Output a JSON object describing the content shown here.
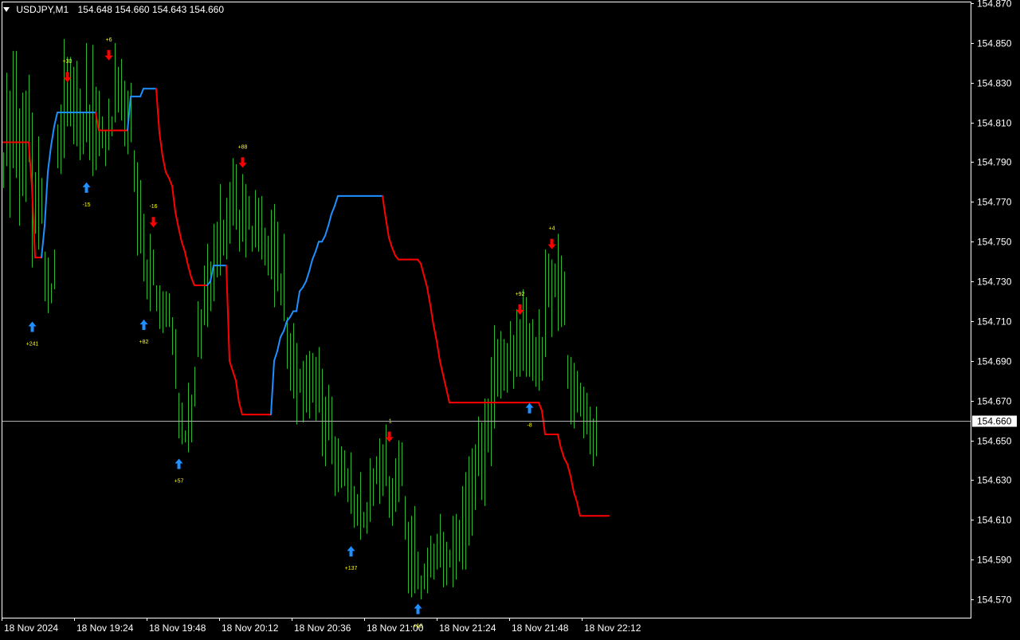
{
  "window": {
    "symbol_label": "USDJPY,M1",
    "ohlc": "154.648 154.660 154.643 154.660"
  },
  "colors": {
    "background": "#000000",
    "frame": "#ffffff",
    "bars": "#2eb82e",
    "trend_up": "#1e90ff",
    "trend_down": "#ff0000",
    "arrow_up": "#1e90ff",
    "arrow_down": "#ff0000",
    "signal_text": "#ffff00",
    "text": "#ffffff",
    "price_line": "#b0b0b0"
  },
  "chart_data": {
    "type": "ohlc-bars",
    "symbol": "USDJPY",
    "timeframe": "M1",
    "ylim": [
      154.565,
      154.87
    ],
    "y_ticks": [
      "154.870",
      "154.850",
      "154.830",
      "154.810",
      "154.790",
      "154.770",
      "154.750",
      "154.730",
      "154.710",
      "154.690",
      "154.670",
      "154.650",
      "154.630",
      "154.610",
      "154.590",
      "154.570"
    ],
    "x_ticks": [
      "18 Nov 2024",
      "18 Nov 19:24",
      "18 Nov 19:48",
      "18 Nov 20:12",
      "18 Nov 20:36",
      "18 Nov 21:00",
      "18 Nov 21:24",
      "18 Nov 21:48",
      "18 Nov 22:12"
    ],
    "bar_count": 183,
    "current_price": "154.660",
    "highs": [
      154.795,
      154.835,
      154.826,
      154.846,
      154.846,
      154.817,
      154.825,
      154.826,
      154.834,
      154.815,
      154.785,
      154.803,
      154.782,
      154.745,
      154.742,
      154.729,
      154.746,
      154.809,
      154.819,
      154.852,
      154.843,
      154.843,
      154.838,
      154.841,
      154.827,
      154.815,
      154.85,
      154.819,
      154.849,
      154.828,
      154.826,
      154.813,
      154.806,
      154.822,
      154.813,
      154.85,
      154.838,
      154.842,
      154.831,
      154.826,
      154.83,
      154.796,
      154.79,
      154.781,
      154.764,
      154.741,
      154.754,
      154.746,
      154.728,
      154.728,
      154.725,
      154.725,
      154.724,
      154.712,
      154.706,
      154.674,
      154.669,
      154.655,
      154.679,
      154.673,
      154.687,
      154.72,
      154.716,
      154.738,
      154.749,
      154.74,
      154.759,
      154.76,
      154.779,
      154.761,
      154.772,
      154.78,
      154.792,
      154.789,
      154.766,
      154.784,
      154.779,
      154.773,
      154.758,
      154.776,
      154.772,
      154.773,
      154.757,
      154.753,
      154.766,
      154.769,
      154.76,
      154.734,
      154.754,
      154.712,
      154.704,
      154.709,
      154.699,
      154.686,
      154.69,
      154.693,
      154.695,
      154.694,
      154.692,
      154.697,
      154.686,
      154.672,
      154.678,
      154.672,
      154.652,
      154.651,
      154.647,
      154.645,
      154.636,
      154.644,
      154.627,
      154.623,
      154.634,
      154.614,
      154.619,
      154.641,
      154.636,
      154.642,
      154.651,
      154.648,
      154.658,
      154.632,
      154.631,
      154.641,
      154.65,
      154.649,
      154.622,
      154.609,
      154.612,
      154.617,
      154.594,
      154.582,
      154.588,
      154.596,
      154.602,
      154.598,
      154.603,
      154.613,
      154.604,
      154.599,
      154.595,
      154.612,
      154.613,
      154.61,
      154.627,
      154.634,
      154.642,
      154.646,
      154.648,
      154.662,
      154.659,
      154.671,
      154.671,
      154.692,
      154.708,
      154.701,
      154.705,
      154.701,
      154.699,
      154.71,
      154.703,
      154.716,
      154.711,
      154.726,
      154.722,
      154.709,
      154.711,
      154.702,
      154.716,
      154.702,
      154.746,
      154.744,
      154.741,
      154.739,
      154.754,
      154.743,
      154.735,
      154.693,
      154.692,
      154.689,
      154.685,
      154.679,
      154.677,
      154.674,
      154.667,
      154.661,
      154.667
    ],
    "lows": [
      154.777,
      154.788,
      154.762,
      154.787,
      154.782,
      154.758,
      154.773,
      154.77,
      154.79,
      154.737,
      154.754,
      154.746,
      154.759,
      154.72,
      154.714,
      154.719,
      154.726,
      154.787,
      154.784,
      154.792,
      154.808,
      154.808,
      154.799,
      154.798,
      154.791,
      154.794,
      154.8,
      154.791,
      154.783,
      154.786,
      154.793,
      154.797,
      154.788,
      154.796,
      154.803,
      154.81,
      154.815,
      154.811,
      154.798,
      154.794,
      154.8,
      154.775,
      154.743,
      154.744,
      154.73,
      154.721,
      154.715,
      154.728,
      154.715,
      154.706,
      154.704,
      154.707,
      154.707,
      154.693,
      154.676,
      154.651,
      154.648,
      154.649,
      154.644,
      154.649,
      154.667,
      154.692,
      154.691,
      154.708,
      154.707,
      154.715,
      154.72,
      154.732,
      154.733,
      154.743,
      154.741,
      154.749,
      154.758,
      154.756,
      154.745,
      154.75,
      154.742,
      154.756,
      154.745,
      154.747,
      154.745,
      154.741,
      154.738,
      154.733,
      154.731,
      154.717,
      154.725,
      154.718,
      154.71,
      154.686,
      154.675,
      154.671,
      154.658,
      154.674,
      154.659,
      154.664,
      154.661,
      154.669,
      154.66,
      154.664,
      154.642,
      154.637,
      154.65,
      154.638,
      154.622,
      154.624,
      154.626,
      154.627,
      154.619,
      154.613,
      154.606,
      154.607,
      154.6,
      154.606,
      154.603,
      154.609,
      154.617,
      154.628,
      154.618,
      154.622,
      154.627,
      154.611,
      154.607,
      154.614,
      154.619,
      154.627,
      154.6,
      154.573,
      154.571,
      154.573,
      154.575,
      154.57,
      154.575,
      154.573,
      154.581,
      154.58,
      154.585,
      154.586,
      154.576,
      154.577,
      154.586,
      154.576,
      154.58,
      154.589,
      154.585,
      154.585,
      154.597,
      154.602,
      154.615,
      154.632,
      154.62,
      154.617,
      154.644,
      154.637,
      154.656,
      154.672,
      154.671,
      154.675,
      154.674,
      154.685,
      154.676,
      154.682,
      154.682,
      154.685,
      154.682,
      154.682,
      154.68,
      154.677,
      154.675,
      154.68,
      154.692,
      154.717,
      154.702,
      154.722,
      154.705,
      154.707,
      154.708,
      154.676,
      154.658,
      154.656,
      154.664,
      154.662,
      154.651,
      154.653,
      154.643,
      154.637,
      154.642
    ],
    "trend": [
      154.8,
      154.8,
      154.8,
      154.8,
      154.8,
      154.8,
      154.8,
      154.8,
      154.8,
      154.778,
      154.742,
      154.742,
      154.742,
      154.758,
      154.785,
      154.798,
      154.808,
      154.815,
      154.815,
      154.815,
      154.815,
      154.815,
      154.815,
      154.815,
      154.815,
      154.815,
      154.815,
      154.815,
      154.815,
      154.815,
      154.806,
      154.806,
      154.806,
      154.806,
      154.806,
      154.806,
      154.806,
      154.806,
      154.806,
      154.806,
      154.823,
      154.823,
      154.823,
      154.823,
      154.827,
      154.827,
      154.827,
      154.827,
      154.827,
      154.805,
      154.793,
      154.785,
      154.782,
      154.778,
      154.765,
      154.757,
      154.75,
      154.745,
      154.738,
      154.732,
      154.728,
      154.728,
      154.728,
      154.728,
      154.728,
      154.73,
      154.738,
      154.738,
      154.738,
      154.738,
      154.738,
      154.69,
      154.685,
      154.68,
      154.669,
      154.663,
      154.663,
      154.663,
      154.663,
      154.663,
      154.663,
      154.663,
      154.663,
      154.663,
      154.663,
      154.69,
      154.695,
      154.702,
      154.705,
      154.71,
      154.712,
      154.715,
      154.715,
      154.725,
      154.727,
      154.73,
      154.735,
      154.741,
      154.745,
      154.75,
      154.75,
      154.753,
      154.758,
      154.764,
      154.768,
      154.773,
      154.773,
      154.773,
      154.773,
      154.773,
      154.773,
      154.773,
      154.773,
      154.773,
      154.773,
      154.773,
      154.773,
      154.773,
      154.773,
      154.773,
      154.762,
      154.752,
      154.747,
      154.743,
      154.741,
      154.741,
      154.741,
      154.741,
      154.741,
      154.741,
      154.741,
      154.739,
      154.733,
      154.727,
      154.718,
      154.708,
      154.7,
      154.69,
      154.683,
      154.676,
      154.669,
      154.669,
      154.669,
      154.669,
      154.669,
      154.669,
      154.669,
      154.669,
      154.669,
      154.669,
      154.669,
      154.669,
      154.669,
      154.669,
      154.669,
      154.669,
      154.669,
      154.669,
      154.669,
      154.669,
      154.669,
      154.669,
      154.669,
      154.669,
      154.669,
      154.669,
      154.669,
      154.669,
      154.669,
      154.665,
      154.653,
      154.653,
      154.653,
      154.653,
      154.653,
      154.646,
      154.641,
      154.638,
      154.632,
      154.624,
      154.619,
      154.612,
      154.612,
      154.612,
      154.612,
      154.612,
      154.612,
      154.612,
      154.612,
      154.612,
      154.612
    ],
    "signals": [
      {
        "type": "buy",
        "bar": 9,
        "price": 154.713,
        "label": "+241"
      },
      {
        "type": "sell",
        "bar": 20,
        "price": 154.827,
        "label": "+30"
      },
      {
        "type": "buy",
        "bar": 26,
        "price": 154.783,
        "label": "-15"
      },
      {
        "type": "sell",
        "bar": 33,
        "price": 154.838,
        "label": "+6"
      },
      {
        "type": "sell",
        "bar": 47,
        "price": 154.754,
        "label": "-16"
      },
      {
        "type": "buy",
        "bar": 44,
        "price": 154.714,
        "label": "+82"
      },
      {
        "type": "buy",
        "bar": 55,
        "price": 154.644,
        "label": "+57"
      },
      {
        "type": "sell",
        "bar": 75,
        "price": 154.784,
        "label": "+88"
      },
      {
        "type": "buy",
        "bar": 109,
        "price": 154.6,
        "label": "+137"
      },
      {
        "type": "sell",
        "bar": 121,
        "price": 154.646,
        "label": "-1"
      },
      {
        "type": "buy",
        "bar": 130,
        "price": 154.571,
        "label": "+18"
      },
      {
        "type": "sell",
        "bar": 162,
        "price": 154.71,
        "label": "+92"
      },
      {
        "type": "buy",
        "bar": 165,
        "price": 154.672,
        "label": "-8"
      },
      {
        "type": "sell",
        "bar": 172,
        "price": 154.743,
        "label": "+4"
      }
    ]
  }
}
